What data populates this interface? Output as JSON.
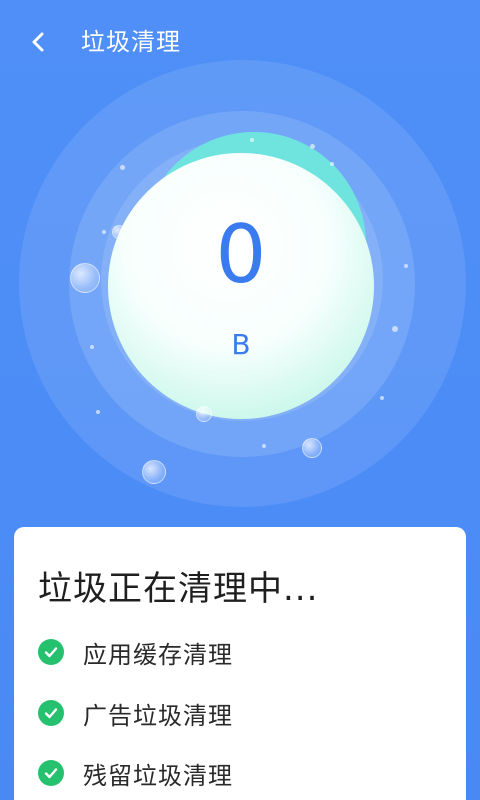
{
  "header": {
    "title": "垃圾清理",
    "back_icon": "chevron-left-icon"
  },
  "gauge": {
    "value": "0",
    "unit": "B"
  },
  "card": {
    "title": "垃圾正在清理中...",
    "tasks": [
      {
        "label": "应用缓存清理",
        "status_icon": "check-circle-icon"
      },
      {
        "label": "广告垃圾清理",
        "status_icon": "check-circle-icon"
      },
      {
        "label": "残留垃圾清理",
        "status_icon": "check-circle-icon"
      }
    ]
  },
  "colors": {
    "background": "#4f8ff7",
    "accent_text": "#3a7cf0",
    "wave": "#6fe4df",
    "success": "#25c16f"
  }
}
